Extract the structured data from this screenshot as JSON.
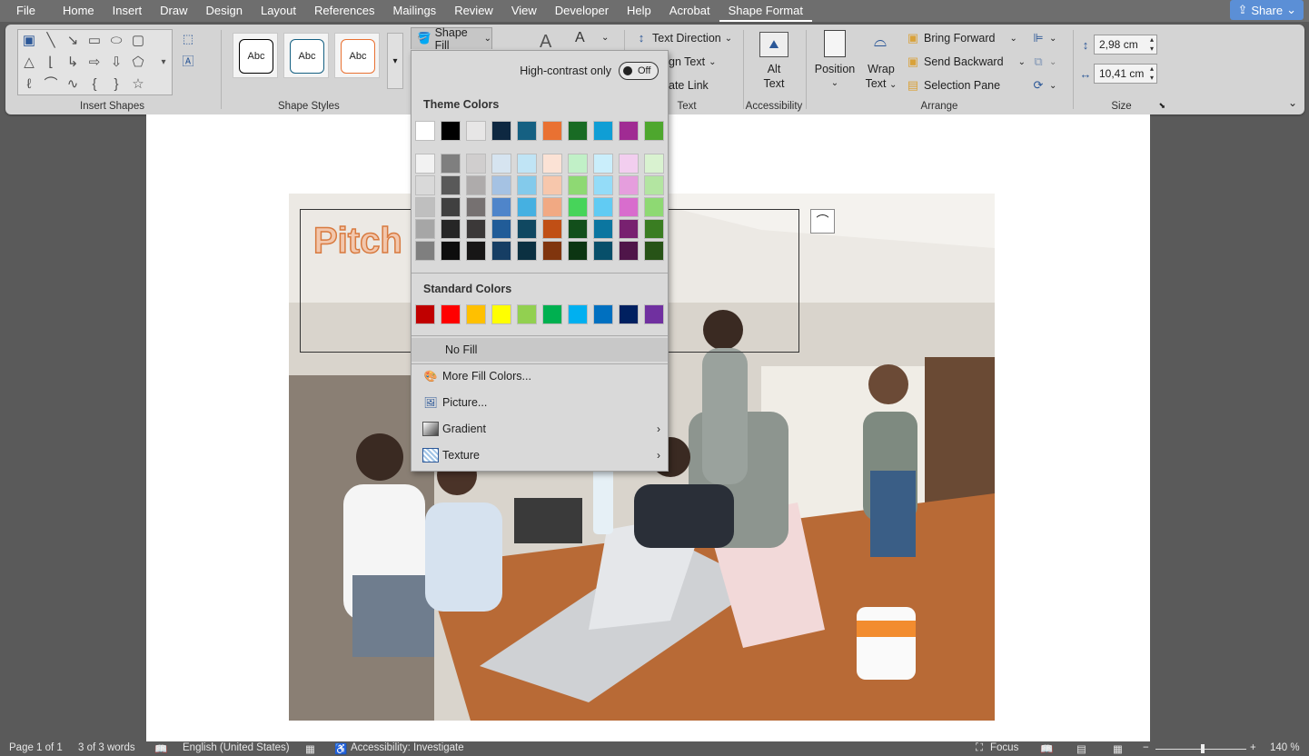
{
  "menubar": {
    "tabs": [
      "File",
      "Home",
      "Insert",
      "Draw",
      "Design",
      "Layout",
      "References",
      "Mailings",
      "Review",
      "View",
      "Developer",
      "Help",
      "Acrobat",
      "Shape Format"
    ],
    "active_tab": "Shape Format",
    "share_label": "Share"
  },
  "ribbon": {
    "groups": {
      "insert_shapes": "Insert Shapes",
      "shape_styles": "Shape Styles",
      "text": "Text",
      "accessibility": "Accessibility",
      "arrange": "Arrange",
      "size": "Size"
    },
    "style_samples": [
      "Abc",
      "Abc",
      "Abc"
    ],
    "shape_fill_label": "Shape Fill",
    "text_direction": "Text Direction",
    "align_text": "gn Text",
    "create_link": "ate Link",
    "alt_text_line1": "Alt",
    "alt_text_line2": "Text",
    "position": "Position",
    "wrap_text_line1": "Wrap",
    "wrap_text_line2": "Text",
    "bring_forward": "Bring Forward",
    "send_backward": "Send Backward",
    "selection_pane": "Selection Pane",
    "height_value": "2,98 cm",
    "width_value": "10,41 cm"
  },
  "document": {
    "textbox_text": "Pitch"
  },
  "fill_menu": {
    "high_contrast_label": "High-contrast only",
    "toggle_state": "Off",
    "theme_title": "Theme Colors",
    "standard_title": "Standard Colors",
    "theme_top_row": [
      "#FFFFFF",
      "#000000",
      "#E7E6E6",
      "#0E2841",
      "#156082",
      "#E97132",
      "#196B24",
      "#0F9ED5",
      "#A02B93",
      "#4EA72E"
    ],
    "theme_shades": [
      [
        "#F2F2F2",
        "#7F7F7F",
        "#D0CECE",
        "#D6E4F0",
        "#C0E4F5",
        "#FBE2D5",
        "#C1F0C7",
        "#CAEEFB",
        "#F2CEEF",
        "#D9F2D0"
      ],
      [
        "#D9D9D9",
        "#595959",
        "#AEABAB",
        "#A5C2E3",
        "#83CAEB",
        "#F7C7AC",
        "#8ED973",
        "#94DCF8",
        "#E59EDD",
        "#B3E5A1"
      ],
      [
        "#BFBFBF",
        "#404040",
        "#767171",
        "#4F85CA",
        "#45B0E1",
        "#F1A983",
        "#47D45A",
        "#61CBF3",
        "#D86DCD",
        "#8ED973"
      ],
      [
        "#A6A6A6",
        "#262626",
        "#3B3838",
        "#215C98",
        "#104861",
        "#C04F15",
        "#124F1B",
        "#0B76A0",
        "#782170",
        "#3A7D22"
      ],
      [
        "#7F7F7F",
        "#0D0D0D",
        "#171616",
        "#163E64",
        "#0B3041",
        "#80350E",
        "#0C3512",
        "#074F6A",
        "#4F1549",
        "#275317"
      ]
    ],
    "standard_colors": [
      "#C00000",
      "#FF0000",
      "#FFC000",
      "#FFFF00",
      "#92D050",
      "#00B050",
      "#00B0F0",
      "#0070C0",
      "#002060",
      "#7030A0"
    ],
    "no_fill": "No Fill",
    "more_fill_colors": "More Fill Colors...",
    "picture": "Picture...",
    "gradient": "Gradient",
    "texture": "Texture"
  },
  "statusbar": {
    "page": "Page 1 of 1",
    "words": "3 of 3 words",
    "language": "English (United States)",
    "accessibility": "Accessibility: Investigate",
    "focus": "Focus",
    "zoom": "140 %"
  }
}
